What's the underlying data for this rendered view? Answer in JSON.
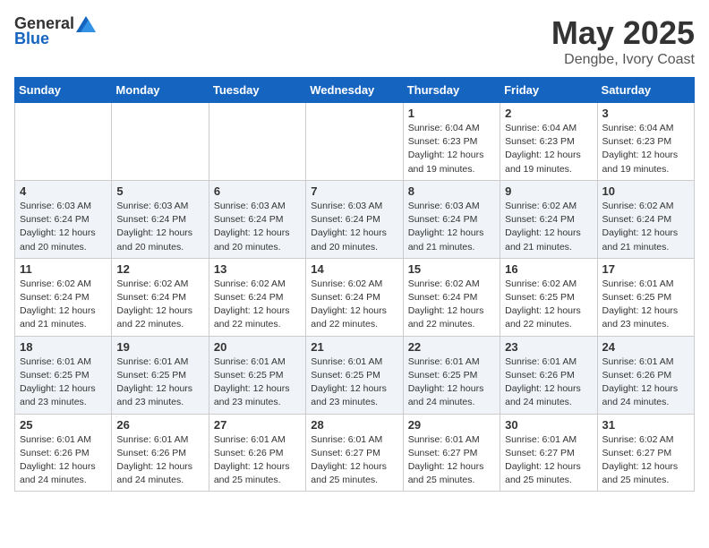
{
  "header": {
    "logo_general": "General",
    "logo_blue": "Blue",
    "month": "May 2025",
    "location": "Dengbe, Ivory Coast"
  },
  "days_of_week": [
    "Sunday",
    "Monday",
    "Tuesday",
    "Wednesday",
    "Thursday",
    "Friday",
    "Saturday"
  ],
  "weeks": [
    [
      {
        "day": "",
        "info": ""
      },
      {
        "day": "",
        "info": ""
      },
      {
        "day": "",
        "info": ""
      },
      {
        "day": "",
        "info": ""
      },
      {
        "day": "1",
        "info": "Sunrise: 6:04 AM\nSunset: 6:23 PM\nDaylight: 12 hours\nand 19 minutes."
      },
      {
        "day": "2",
        "info": "Sunrise: 6:04 AM\nSunset: 6:23 PM\nDaylight: 12 hours\nand 19 minutes."
      },
      {
        "day": "3",
        "info": "Sunrise: 6:04 AM\nSunset: 6:23 PM\nDaylight: 12 hours\nand 19 minutes."
      }
    ],
    [
      {
        "day": "4",
        "info": "Sunrise: 6:03 AM\nSunset: 6:24 PM\nDaylight: 12 hours\nand 20 minutes."
      },
      {
        "day": "5",
        "info": "Sunrise: 6:03 AM\nSunset: 6:24 PM\nDaylight: 12 hours\nand 20 minutes."
      },
      {
        "day": "6",
        "info": "Sunrise: 6:03 AM\nSunset: 6:24 PM\nDaylight: 12 hours\nand 20 minutes."
      },
      {
        "day": "7",
        "info": "Sunrise: 6:03 AM\nSunset: 6:24 PM\nDaylight: 12 hours\nand 20 minutes."
      },
      {
        "day": "8",
        "info": "Sunrise: 6:03 AM\nSunset: 6:24 PM\nDaylight: 12 hours\nand 21 minutes."
      },
      {
        "day": "9",
        "info": "Sunrise: 6:02 AM\nSunset: 6:24 PM\nDaylight: 12 hours\nand 21 minutes."
      },
      {
        "day": "10",
        "info": "Sunrise: 6:02 AM\nSunset: 6:24 PM\nDaylight: 12 hours\nand 21 minutes."
      }
    ],
    [
      {
        "day": "11",
        "info": "Sunrise: 6:02 AM\nSunset: 6:24 PM\nDaylight: 12 hours\nand 21 minutes."
      },
      {
        "day": "12",
        "info": "Sunrise: 6:02 AM\nSunset: 6:24 PM\nDaylight: 12 hours\nand 22 minutes."
      },
      {
        "day": "13",
        "info": "Sunrise: 6:02 AM\nSunset: 6:24 PM\nDaylight: 12 hours\nand 22 minutes."
      },
      {
        "day": "14",
        "info": "Sunrise: 6:02 AM\nSunset: 6:24 PM\nDaylight: 12 hours\nand 22 minutes."
      },
      {
        "day": "15",
        "info": "Sunrise: 6:02 AM\nSunset: 6:24 PM\nDaylight: 12 hours\nand 22 minutes."
      },
      {
        "day": "16",
        "info": "Sunrise: 6:02 AM\nSunset: 6:25 PM\nDaylight: 12 hours\nand 22 minutes."
      },
      {
        "day": "17",
        "info": "Sunrise: 6:01 AM\nSunset: 6:25 PM\nDaylight: 12 hours\nand 23 minutes."
      }
    ],
    [
      {
        "day": "18",
        "info": "Sunrise: 6:01 AM\nSunset: 6:25 PM\nDaylight: 12 hours\nand 23 minutes."
      },
      {
        "day": "19",
        "info": "Sunrise: 6:01 AM\nSunset: 6:25 PM\nDaylight: 12 hours\nand 23 minutes."
      },
      {
        "day": "20",
        "info": "Sunrise: 6:01 AM\nSunset: 6:25 PM\nDaylight: 12 hours\nand 23 minutes."
      },
      {
        "day": "21",
        "info": "Sunrise: 6:01 AM\nSunset: 6:25 PM\nDaylight: 12 hours\nand 23 minutes."
      },
      {
        "day": "22",
        "info": "Sunrise: 6:01 AM\nSunset: 6:25 PM\nDaylight: 12 hours\nand 24 minutes."
      },
      {
        "day": "23",
        "info": "Sunrise: 6:01 AM\nSunset: 6:26 PM\nDaylight: 12 hours\nand 24 minutes."
      },
      {
        "day": "24",
        "info": "Sunrise: 6:01 AM\nSunset: 6:26 PM\nDaylight: 12 hours\nand 24 minutes."
      }
    ],
    [
      {
        "day": "25",
        "info": "Sunrise: 6:01 AM\nSunset: 6:26 PM\nDaylight: 12 hours\nand 24 minutes."
      },
      {
        "day": "26",
        "info": "Sunrise: 6:01 AM\nSunset: 6:26 PM\nDaylight: 12 hours\nand 24 minutes."
      },
      {
        "day": "27",
        "info": "Sunrise: 6:01 AM\nSunset: 6:26 PM\nDaylight: 12 hours\nand 25 minutes."
      },
      {
        "day": "28",
        "info": "Sunrise: 6:01 AM\nSunset: 6:27 PM\nDaylight: 12 hours\nand 25 minutes."
      },
      {
        "day": "29",
        "info": "Sunrise: 6:01 AM\nSunset: 6:27 PM\nDaylight: 12 hours\nand 25 minutes."
      },
      {
        "day": "30",
        "info": "Sunrise: 6:01 AM\nSunset: 6:27 PM\nDaylight: 12 hours\nand 25 minutes."
      },
      {
        "day": "31",
        "info": "Sunrise: 6:02 AM\nSunset: 6:27 PM\nDaylight: 12 hours\nand 25 minutes."
      }
    ]
  ]
}
